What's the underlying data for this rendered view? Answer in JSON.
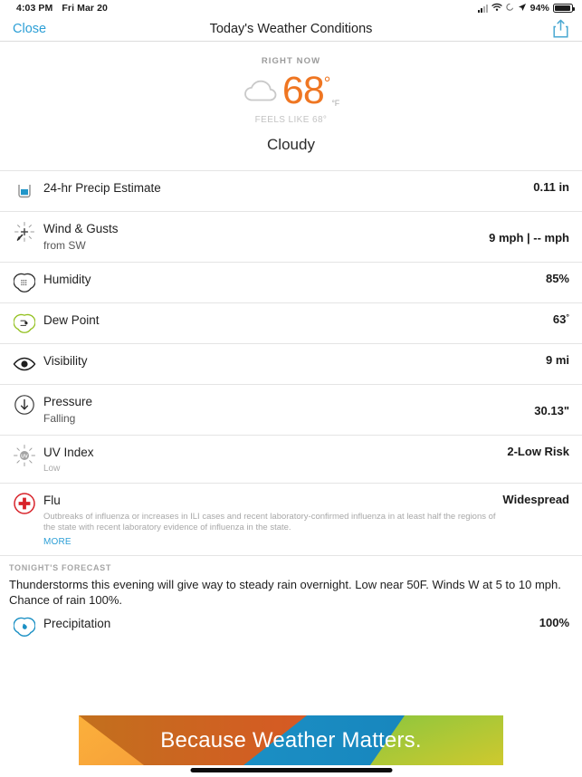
{
  "status_bar": {
    "time": "4:03 PM",
    "date": "Fri Mar 20",
    "battery_percent": "94%",
    "icons": [
      "cellular-signal-icon",
      "wifi-icon",
      "rotation-lock-icon",
      "location-arrow-icon",
      "battery-icon"
    ]
  },
  "nav": {
    "close_label": "Close",
    "title": "Today's Weather Conditions",
    "share_icon": "share-icon"
  },
  "hero": {
    "label": "RIGHT NOW",
    "icon": "cloud-icon",
    "temperature": "68",
    "degree": "°",
    "unit": "°F",
    "feels_like": "FEELS LIKE 68°",
    "condition": "Cloudy"
  },
  "colors": {
    "accent_blue": "#2c9fd6",
    "temp_orange": "#ef7622",
    "flu_red": "#d8232a",
    "dew_green": "#93c01f",
    "precip_blue": "#1b90c4"
  },
  "rows": [
    {
      "icon": "rain-gauge-icon",
      "title": "24-hr Precip Estimate",
      "subtitle": "",
      "value": "0.11 in"
    },
    {
      "icon": "wind-compass-icon",
      "title": "Wind & Gusts",
      "subtitle": "from SW",
      "value": "9 mph | -- mph"
    },
    {
      "icon": "humidity-gauge-icon",
      "title": "Humidity",
      "subtitle": "",
      "value": "85%"
    },
    {
      "icon": "dew-point-icon",
      "title": "Dew Point",
      "subtitle": "",
      "value": "63",
      "value_suffix": "°"
    },
    {
      "icon": "eye-icon",
      "title": "Visibility",
      "subtitle": "",
      "value": "9 mi"
    },
    {
      "icon": "pressure-down-arrow-icon",
      "title": "Pressure",
      "subtitle": "Falling",
      "value": "30.13\""
    },
    {
      "icon": "uv-sun-icon",
      "title": "UV Index",
      "small_subtitle": "Low",
      "value": "2-Low Risk"
    },
    {
      "icon": "flu-cross-icon",
      "title": "Flu",
      "value": "Widespread",
      "description": "Outbreaks of influenza or increases in ILI cases and recent laboratory-confirmed influenza in at least half the regions of the state with recent laboratory evidence of influenza in the state.",
      "more_label": "MORE"
    }
  ],
  "forecast": {
    "label": "TONIGHT'S FORECAST",
    "text": "Thunderstorms this evening will give way to steady rain overnight. Low near 50F. Winds W at 5 to 10 mph. Chance of rain 100%."
  },
  "precipitation_row": {
    "icon": "precipitation-gauge-icon",
    "title": "Precipitation",
    "value": "100%"
  },
  "banner": {
    "text": "Because Weather Matters.",
    "colors": [
      "#f9a73e",
      "#b5651d",
      "#e8452a",
      "#1b8fc4",
      "#8cc63e"
    ]
  }
}
